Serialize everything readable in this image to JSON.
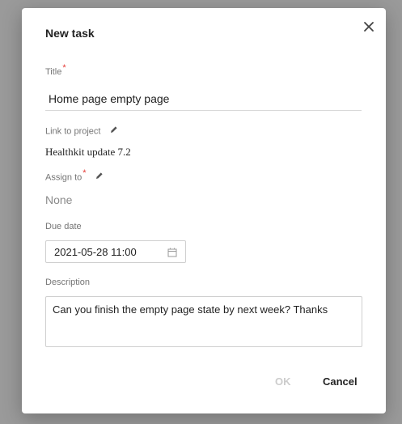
{
  "dialog": {
    "title": "New task",
    "close_icon": "close-icon"
  },
  "fields": {
    "title": {
      "label": "Title",
      "required_mark": "*",
      "value": "Home page empty page"
    },
    "project": {
      "label": "Link to project",
      "edit_icon": "pencil-icon",
      "value": "Healthkit update 7.2"
    },
    "assign": {
      "label": "Assign to",
      "required_mark": "*",
      "edit_icon": "pencil-icon",
      "value": "None"
    },
    "due_date": {
      "label": "Due date",
      "value": "2021-05-28 11:00",
      "icon": "calendar-icon"
    },
    "description": {
      "label": "Description",
      "value": "Can you finish the empty page state by next week? Thanks"
    }
  },
  "actions": {
    "ok_label": "OK",
    "ok_disabled": true,
    "cancel_label": "Cancel"
  },
  "colors": {
    "required": "#e53935",
    "backdrop": "#9a9a9a",
    "disabled_text": "#cccccc"
  }
}
